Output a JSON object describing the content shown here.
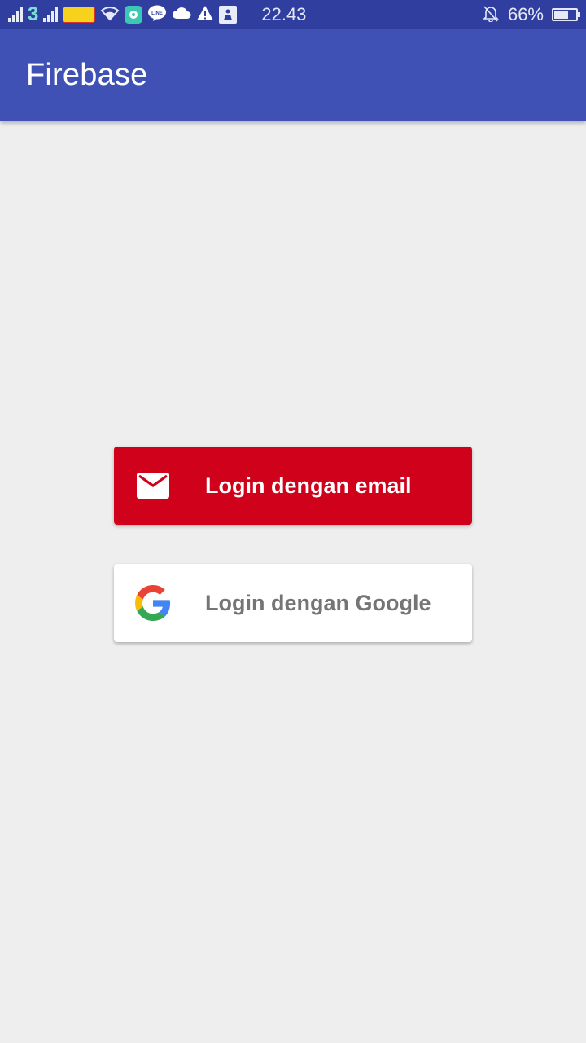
{
  "status_bar": {
    "carrier_1_name": "3",
    "time": "22.43",
    "battery_percent": "66%",
    "battery_level": 0.66,
    "icons": [
      "signal-icon",
      "carrier-3-icon",
      "signal-icon",
      "indosat-ooredoo-icon",
      "wifi-icon",
      "chat-app-icon",
      "line-icon",
      "cloud-icon",
      "warning-icon",
      "download-icon",
      "bell-muted-icon",
      "battery-icon"
    ]
  },
  "app_bar": {
    "title": "Firebase",
    "color": "#3f51b5"
  },
  "buttons": {
    "email": {
      "label": "Login dengan email",
      "icon": "mail-icon",
      "color": "#d0021b"
    },
    "google": {
      "label": "Login dengan Google",
      "icon": "google-g-icon",
      "color": "#ffffff"
    }
  }
}
